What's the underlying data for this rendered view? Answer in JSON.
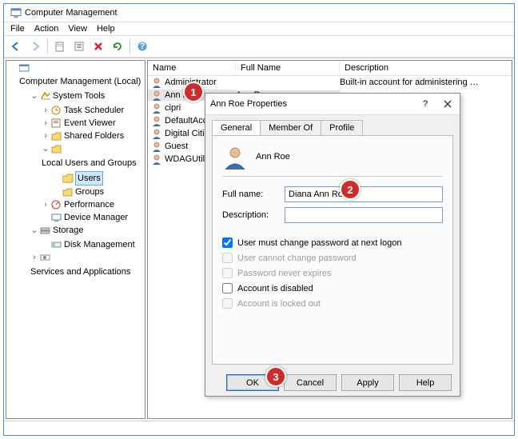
{
  "window": {
    "title": "Computer Management"
  },
  "menu": {
    "file": "File",
    "action": "Action",
    "view": "View",
    "help": "Help"
  },
  "tree": {
    "root": "Computer Management (Local)",
    "system_tools": "System Tools",
    "task_scheduler": "Task Scheduler",
    "event_viewer": "Event Viewer",
    "shared_folders": "Shared Folders",
    "local_users": "Local Users and Groups",
    "users": "Users",
    "groups": "Groups",
    "performance": "Performance",
    "device_manager": "Device Manager",
    "storage": "Storage",
    "disk_management": "Disk Management",
    "services_apps": "Services and Applications"
  },
  "list": {
    "headers": {
      "name": "Name",
      "fullname": "Full Name",
      "desc": "Description"
    },
    "rows": [
      {
        "name": "Administrator",
        "fullname": "",
        "desc": "Built-in account for administering …"
      },
      {
        "name": "Ann Roe",
        "fullname": "Ann Roe",
        "desc": ""
      },
      {
        "name": "cipri",
        "fullname": "",
        "desc": ""
      },
      {
        "name": "DefaultAcco…",
        "fullname": "",
        "desc": ""
      },
      {
        "name": "Digital Citizen",
        "fullname": "",
        "desc": ""
      },
      {
        "name": "Guest",
        "fullname": "",
        "desc": ""
      },
      {
        "name": "WDAGUtility…",
        "fullname": "",
        "desc": ""
      }
    ]
  },
  "dialog": {
    "title": "Ann Roe Properties",
    "tabs": {
      "general": "General",
      "memberof": "Member Of",
      "profile": "Profile"
    },
    "display_name": "Ann Roe",
    "fullname_label": "Full name:",
    "fullname_value": "Diana Ann Roe",
    "desc_label": "Description:",
    "desc_value": "",
    "chk_mustchange": "User must change password at next logon",
    "chk_cannotchange": "User cannot change password",
    "chk_neverexpires": "Password never expires",
    "chk_disabled": "Account is disabled",
    "chk_locked": "Account is locked out",
    "buttons": {
      "ok": "OK",
      "cancel": "Cancel",
      "apply": "Apply",
      "help": "Help"
    }
  },
  "callouts": {
    "c1": "1",
    "c2": "2",
    "c3": "3"
  }
}
